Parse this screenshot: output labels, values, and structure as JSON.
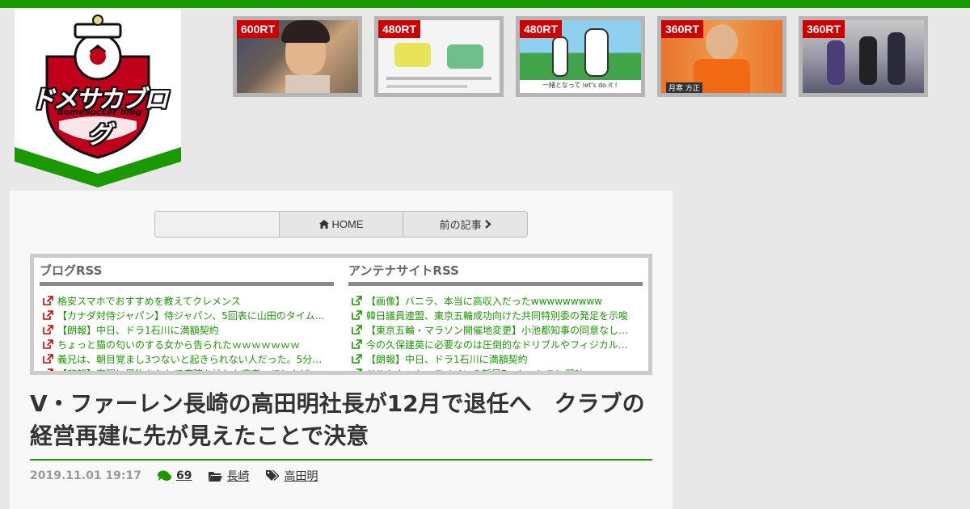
{
  "site": {
    "logo_title": "ドメサカブログ",
    "logo_subtitle": "domesoccer blog",
    "accent": "#1a9a00",
    "badge_red": "#d10000"
  },
  "thumbnails": [
    {
      "badge": "600RT",
      "caption": ""
    },
    {
      "badge": "480RT",
      "caption": ""
    },
    {
      "badge": "480RT",
      "caption": "一緒となって let's do it !"
    },
    {
      "badge": "360RT",
      "caption": "月寒 方正"
    },
    {
      "badge": "360RT",
      "caption": ""
    }
  ],
  "nav": {
    "blank": "",
    "home": "HOME",
    "prev": "前の記事"
  },
  "rss": {
    "blog": {
      "heading": "ブログRSS",
      "items": [
        "格安スマホでおすすめを教えてクレメンス",
        "【カナダ対侍ジャパン】侍ジャパン、5回表に山田のタイム…",
        "【朗報】中日、ドラ1石川に満額契約",
        "ちょっと猫の匂いのする女から告られたｗｗｗｗｗｗｗ",
        "義兄は、朝目覚まし3つないと起きられない人だった。5分…",
        "【悲報】直腸に異物を入れて病院を訪れた患者、ほとんど…"
      ]
    },
    "antenna": {
      "heading": "アンテナサイトRSS",
      "items": [
        "【画像】バニラ、本当に高収入だったwwwwwwwww",
        "韓日議員連盟、東京五輪成功向けた共同特別委の発足を示唆",
        "【東京五輪・マラソン開催地変更】小池都知事の同意なし…",
        "今の久保建英に必要なのは圧倒的なドリブルやフィジカル…",
        "【朗報】中日、ドラ1石川に満額契約",
        "ドルトムント、スペインの新星F・トーレスに興味"
      ]
    }
  },
  "article": {
    "title": "V・ファーレン長崎の高田明社長が12月で退任へ　クラブの経営再建に先が見えたことで決意",
    "date": "2019.11.01 19:17",
    "comments": "69",
    "category": "長崎",
    "tag": "高田明"
  }
}
